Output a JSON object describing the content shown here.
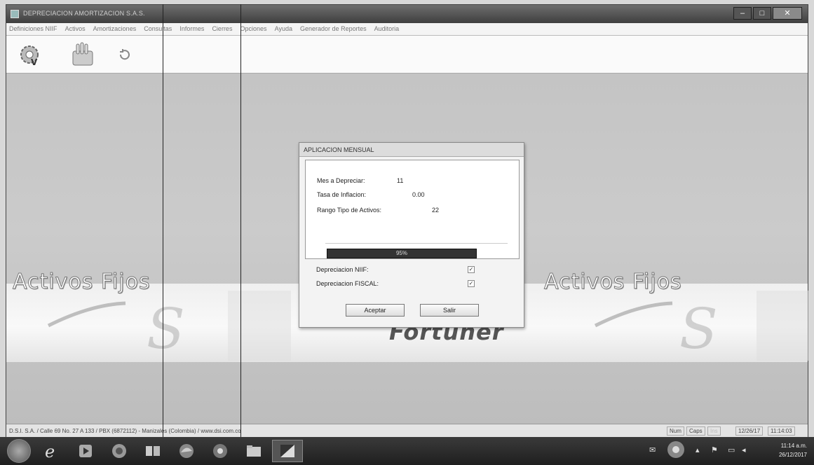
{
  "window": {
    "title": "DEPRECIACION AMORTIZACION S.A.S.",
    "controls": [
      "–",
      "□",
      "✕"
    ]
  },
  "menu": [
    "Definiciones NIIF",
    "Activos",
    "Amortizaciones",
    "Consultas",
    "Informes",
    "Cierres",
    "Opciones",
    "Ayuda",
    "Generador de Reportes",
    "Auditoria"
  ],
  "toolbar": {
    "icons": [
      "gear-icon",
      "hand-icon",
      "refresh-icon"
    ]
  },
  "brand": {
    "left": "Activos Fijos",
    "right": "Activos Fijos",
    "center": "Fortuner"
  },
  "dialog": {
    "title": "APLICACION MENSUAL",
    "mes_label": "Mes a Depreciar:",
    "mes_value": "11",
    "tasa_label": "Tasa de Inflacion:",
    "tasa_value": "0.00",
    "rango_label": "Rango Tipo de Activos:",
    "rango_value": "22",
    "progress_text": "95%",
    "progress_value": 95,
    "dep_niif_label": "Depreciacion NIIF:",
    "dep_fiscal_label": "Depreciacion FISCAL:",
    "dep_niif_checked": true,
    "dep_fiscal_checked": true,
    "accept_label": "Aceptar",
    "exit_label": "Salir"
  },
  "status": {
    "company": "D.S.I. S.A. / Calle 69 No. 27 A 133 / PBX (6872112) - Manizales (Colombia) / www.dsi.com.co",
    "num": "Num",
    "caps": "Caps",
    "ins": "Ins",
    "date": "12/26/17",
    "time": "11:14:03"
  },
  "taskbar": {
    "clock_time": "11:14 a.m.",
    "clock_date": "26/12/2017",
    "apps": [
      "media-player-icon",
      "explorer-icon",
      "browser-icon",
      "firefox-icon",
      "library-icon",
      "chrome-icon",
      "folder-icon",
      "app-icon"
    ]
  }
}
